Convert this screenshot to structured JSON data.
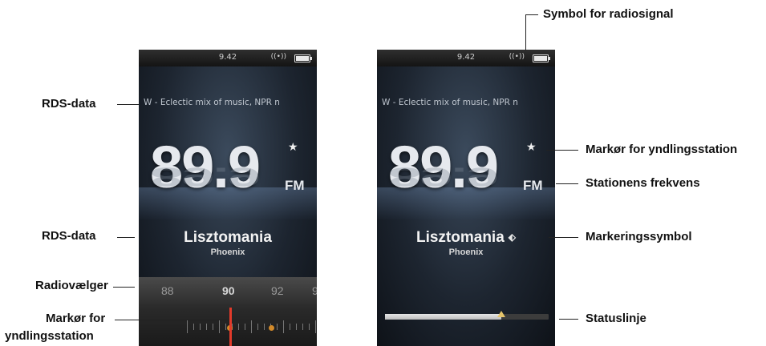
{
  "screen_left": {
    "status": {
      "time": "9.42",
      "signal_icon": "((•))"
    },
    "rds_text": "W - Eclectic mix of music, NPR n",
    "frequency": "89.9",
    "band": "FM",
    "favorite_icon": "★",
    "song": "Lisztomania",
    "artist": "Phoenix",
    "tuner_labels": [
      "88",
      "90",
      "92",
      "9"
    ]
  },
  "screen_right": {
    "status": {
      "time": "9.42",
      "signal_icon": "((•))"
    },
    "rds_text": "W - Eclectic mix of music, NPR n",
    "frequency": "89.9",
    "band": "FM",
    "favorite_icon": "★",
    "song": "Lisztomania",
    "artist": "Phoenix",
    "tag_icon": "⬖",
    "progress": 0.71
  },
  "callouts": {
    "rds_top": "RDS-data",
    "rds_mid": "RDS-data",
    "tuner": "Radiovælger",
    "fav_marker_l1": "Markør for",
    "fav_marker_l2": "yndlingsstation",
    "signal": "Symbol for radiosignal",
    "fav_marker_right": "Markør for yndlingsstation",
    "station_freq": "Stationens frekvens",
    "tag_symbol": "Markeringssymbol",
    "status_line": "Statuslinje"
  }
}
